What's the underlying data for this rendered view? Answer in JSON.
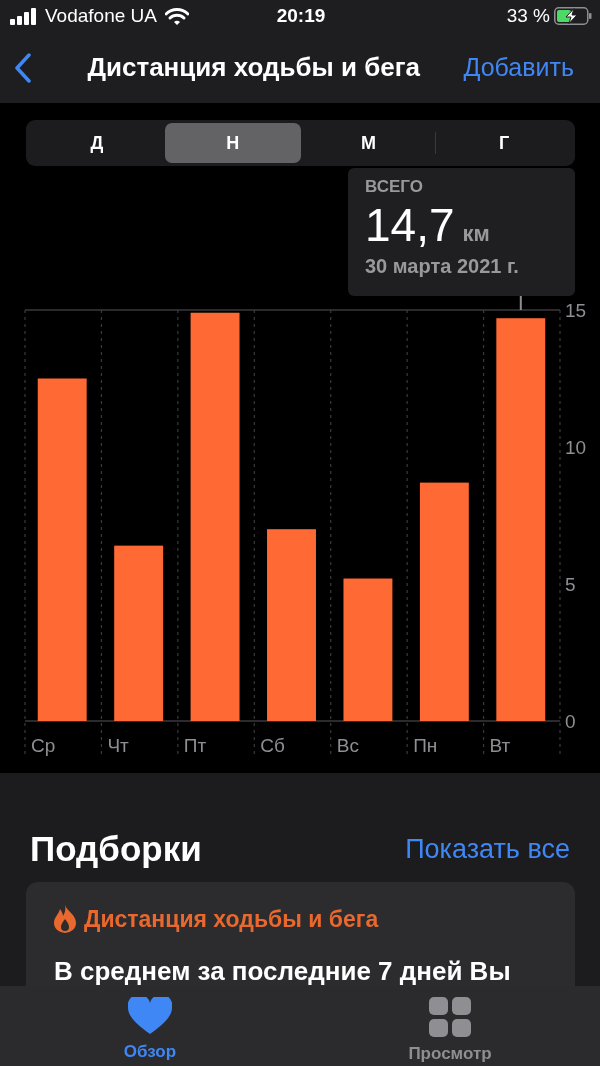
{
  "status_bar": {
    "carrier": "Vodafone UA",
    "time": "20:19",
    "battery": "33 %"
  },
  "nav": {
    "title": "Дистанция ходьбы и бега",
    "action": "Добавить"
  },
  "period_tabs": [
    {
      "label": "Д",
      "selected": false
    },
    {
      "label": "Н",
      "selected": true
    },
    {
      "label": "М",
      "selected": false
    },
    {
      "label": "Г",
      "selected": false
    }
  ],
  "summary": {
    "label": "ВСЕГО",
    "value": "14,7",
    "unit": "км",
    "date": "30 марта 2021 г."
  },
  "chart": {
    "chart_data": {
      "type": "bar",
      "categories": [
        "Ср",
        "Чт",
        "Пт",
        "Сб",
        "Вс",
        "Пн",
        "Вт"
      ],
      "values": [
        12.5,
        6.4,
        14.9,
        7.0,
        5.2,
        8.7,
        14.7
      ],
      "ylim": [
        0,
        15
      ],
      "yticks": [
        0,
        5,
        10,
        15
      ]
    }
  },
  "highlights": {
    "title": "Подборки",
    "action": "Показать все",
    "cards": [
      {
        "title": "Дистанция ходьбы и бега",
        "text": "В среднем за последние 7 дней Вы"
      }
    ]
  },
  "tab_bar": [
    {
      "kind": "heart",
      "label": "Обзор",
      "selected": true
    },
    {
      "kind": "grid",
      "label": "Просмотр",
      "selected": false
    }
  ]
}
